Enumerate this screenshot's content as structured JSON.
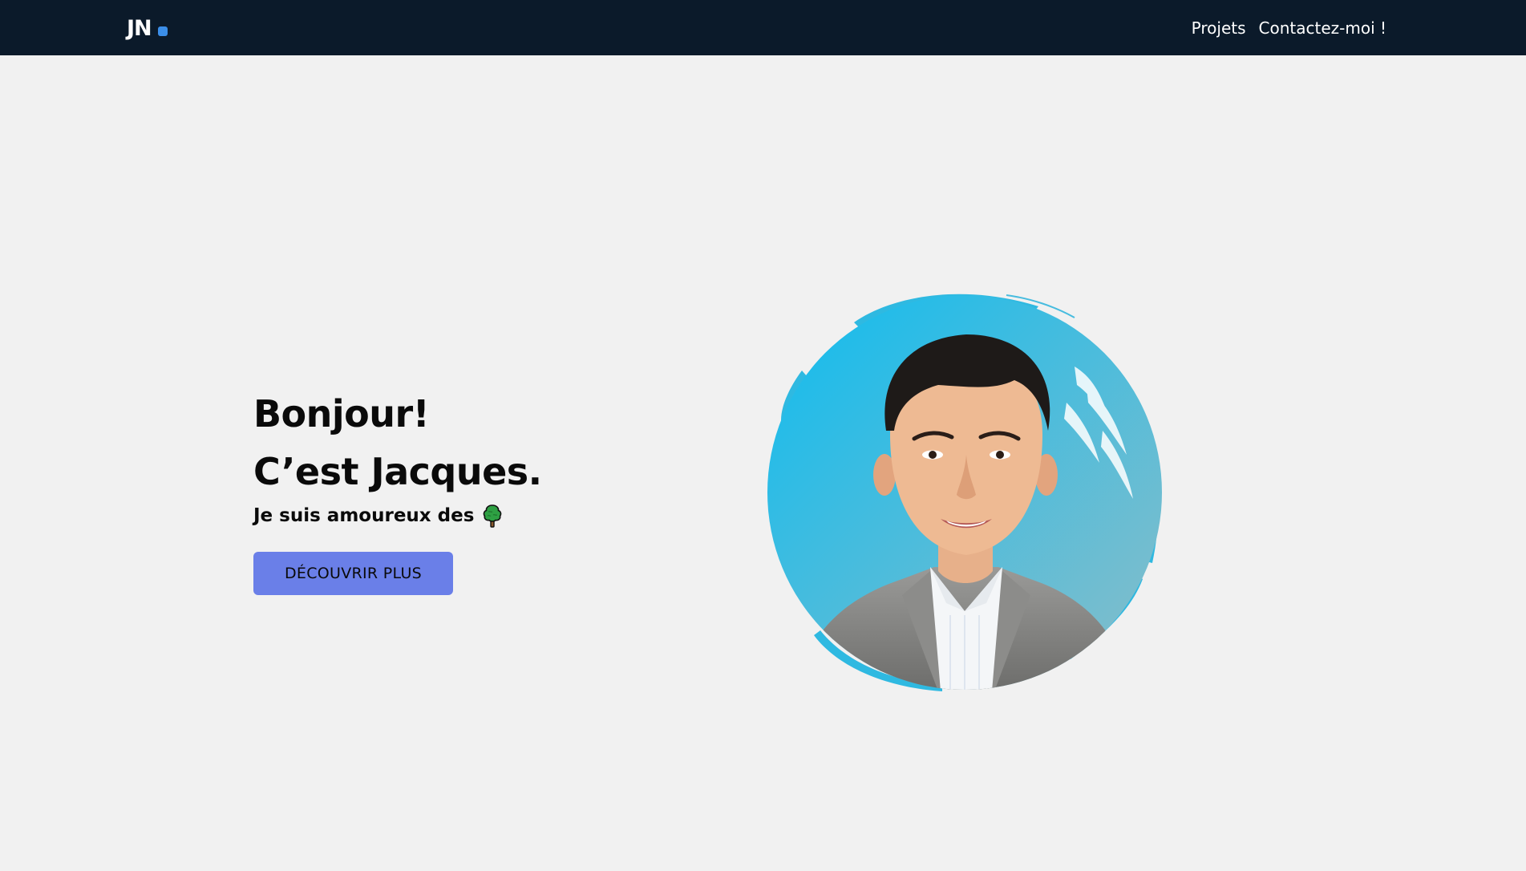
{
  "header": {
    "logo_text": "JN",
    "nav": [
      {
        "label": "Projets"
      },
      {
        "label": "Contactez-moi !"
      }
    ]
  },
  "hero": {
    "line1": "Bonjour!",
    "line2": "C’est Jacques.",
    "tagline": "Je suis amoureux des",
    "tagline_icon": "deciduous-tree-icon",
    "cta_label": "DÉCOUVRIR PLUS"
  },
  "portrait": {
    "icon": "profile-photo"
  },
  "colors": {
    "nav_bg": "#0b1a2a",
    "page_bg": "#f1f1f1",
    "logo_dot": "#3b8ee8",
    "cta_bg": "#6a7fe8",
    "portrait_bg_top": "#0fbcef",
    "portrait_bg_bottom": "#8bbdc8"
  }
}
